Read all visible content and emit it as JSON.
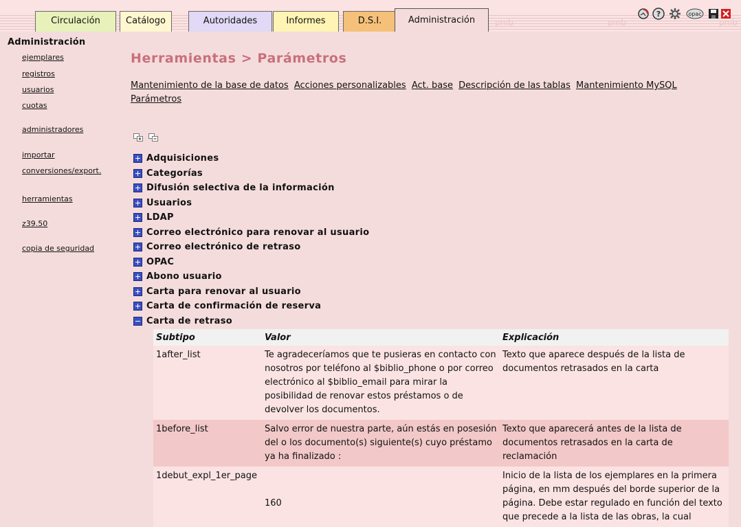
{
  "tabs": [
    {
      "label": "Circulación",
      "active": false
    },
    {
      "label": "Catálogo",
      "active": false
    },
    {
      "label": "Autoridades",
      "active": false
    },
    {
      "label": "Informes",
      "active": false
    },
    {
      "label": "D.S.I.",
      "active": false
    },
    {
      "label": "Administración",
      "active": true
    }
  ],
  "watermarks": [
    "pmb",
    "pmb",
    "pmb"
  ],
  "top_icons": [
    "refresh-icon",
    "help-icon",
    "settings-icon",
    "opac-icon",
    "save-icon",
    "exit-icon"
  ],
  "top_icon_opac_text": "opac",
  "sidebar": {
    "title": "Administración",
    "links": [
      "ejemplares",
      "registros",
      "usuarios",
      "cuotas",
      "administradores",
      "importar",
      "conversiones/export.",
      "herramientas",
      "z39.50",
      "copia de seguridad"
    ]
  },
  "main": {
    "title": "Herramientas > Parámetros",
    "tool_links": [
      "Mantenimiento de la base de datos",
      "Acciones personalizables",
      "Act. base",
      "Descripción de las tablas",
      "Mantenimiento MySQL",
      "Parámetros"
    ],
    "categories": [
      {
        "label": "Adquisiciones",
        "expanded": false
      },
      {
        "label": "Categorías",
        "expanded": false
      },
      {
        "label": "Difusión selectiva de la información",
        "expanded": false
      },
      {
        "label": "Usuarios",
        "expanded": false
      },
      {
        "label": "LDAP",
        "expanded": false
      },
      {
        "label": "Correo electrónico para renovar al usuario",
        "expanded": false
      },
      {
        "label": "Correo electrónico de retraso",
        "expanded": false
      },
      {
        "label": "OPAC",
        "expanded": false
      },
      {
        "label": "Abono usuario",
        "expanded": false
      },
      {
        "label": "Carta para renovar al usuario",
        "expanded": false
      },
      {
        "label": "Carta de confirmación de reserva",
        "expanded": false
      },
      {
        "label": "Carta de retraso",
        "expanded": true
      }
    ],
    "table": {
      "headers": [
        "Subtipo",
        "Valor",
        "Explicación"
      ],
      "rows": [
        {
          "subtipo": "1after_list",
          "valor": "Te agradeceríamos que te pusieras en contacto con nosotros por teléfono al $biblio_phone o por correo electrónico al $biblio_email para mirar la posibilidad de renovar estos préstamos o de devolver los documentos.",
          "explicacion": "Texto que aparece después de la lista de documentos retrasados en la carta"
        },
        {
          "subtipo": "1before_list",
          "valor": "Salvo error de nuestra parte, aún estás en posesión del o los documento(s) siguiente(s) cuyo préstamo ya ha finalizado :",
          "explicacion": "Texto que aparecerá antes de la lista de documentos retrasados en la carta de reclamación"
        },
        {
          "subtipo": "1debut_expl_1er_page",
          "valor": "160",
          "explicacion": "Inicio de la lista de los ejemplares en la primera página, en mm después del borde superior de la página. Debe estar regulado en función del texto que precede a la lista de las obras, la cual"
        }
      ]
    }
  }
}
